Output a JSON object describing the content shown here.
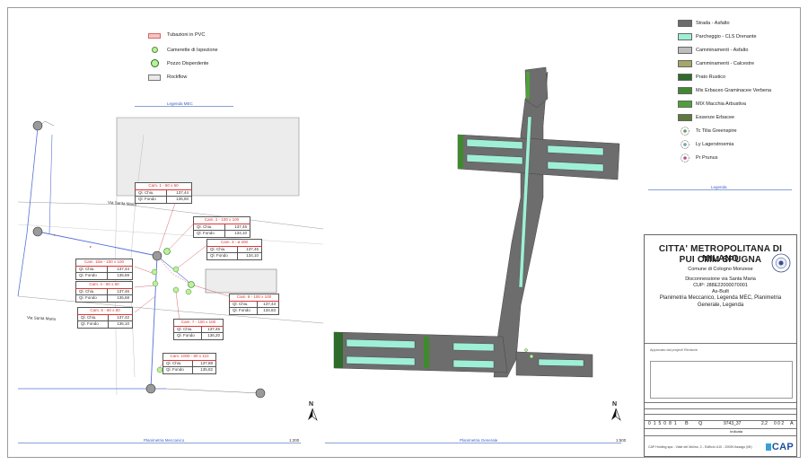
{
  "legend_left": {
    "items": [
      {
        "label": "Tubazioni in PVC",
        "symbol": "pvc-pipe"
      },
      {
        "label": "Camerette di Ispezione",
        "symbol": "inspection-chamber"
      },
      {
        "label": "Pozzo Disperdente",
        "symbol": "dispersing-well"
      },
      {
        "label": "Rockflow",
        "symbol": "rockflow"
      }
    ],
    "caption": "Legenda MEC"
  },
  "left_plan": {
    "street_labels": [
      "Via Santa Maria",
      "Via Santa Maria"
    ],
    "chambers": [
      {
        "title": "Cam. 1 - 60 x 60",
        "rows": [
          [
            "Ql. Chiu.",
            "137,44"
          ],
          [
            "Ql. Fondo",
            "135,80"
          ]
        ]
      },
      {
        "title": "Cam. 2 - 100 x 100",
        "rows": [
          [
            "Ql. Chiu.",
            "137,45"
          ],
          [
            "Ql. Fondo",
            "134,10"
          ]
        ]
      },
      {
        "title": "Cam. 3 - ø 200",
        "rows": [
          [
            "Ql. Chiu.",
            "137,45"
          ],
          [
            "Ql. Fondo",
            "134,10"
          ]
        ]
      },
      {
        "title": "Cam. 1bis - 100 x 100",
        "rows": [
          [
            "Ql. Chiu.",
            "137,44"
          ],
          [
            "Ql. Fondo",
            "135,59"
          ]
        ]
      },
      {
        "title": "Cam. 4 - 60 x 60",
        "rows": [
          [
            "Ql. Chiu.",
            "137,46"
          ],
          [
            "Ql. Fondo",
            "135,68"
          ]
        ]
      },
      {
        "title": "Cam. 6 - 60 x 60",
        "rows": [
          [
            "Ql. Chiu.",
            "137,42"
          ],
          [
            "Ql. Fondo",
            "136,10"
          ]
        ]
      },
      {
        "title": "Cam. 8 - 100 x 100",
        "rows": [
          [
            "Ql. Chiu.",
            "137,43"
          ],
          [
            "Ql. Fondo",
            "134,83"
          ]
        ]
      },
      {
        "title": "Cam. 7 - 100 x 100",
        "rows": [
          [
            "Ql. Chiu.",
            "137,45"
          ],
          [
            "Ql. Fondo",
            "136,20"
          ]
        ]
      },
      {
        "title": "Cam. 1000 - 80 x 110",
        "rows": [
          [
            "Ql. Chiu.",
            "137,88"
          ],
          [
            "Ql. Fondo",
            "135,82"
          ]
        ]
      }
    ],
    "caption": "Planimetria Meccanico",
    "scale": "1:200"
  },
  "right_plan": {
    "caption": "Planimetria Generale",
    "scale": "1:500"
  },
  "north_label": "N",
  "legend_right": {
    "items": [
      {
        "label": "Strada - Asfalto",
        "color": "#6d6d6d"
      },
      {
        "label": "Parcheggio - CLS Drenante",
        "color": "#9fefd6"
      },
      {
        "label": "Camminamenti - Asfalto",
        "color": "#bdbdbd"
      },
      {
        "label": "Camminamenti - Calcestre",
        "color": "#a6a668"
      },
      {
        "label": "Prato Rustico",
        "color": "#2f6b2a"
      },
      {
        "label": "Mix Erbaceo Graminacee Verbena",
        "color": "#3f8a2e"
      },
      {
        "label": "MIX Macchia Arbustiva",
        "color": "#4fa03a"
      },
      {
        "label": "Essenze Erbacee",
        "color": "#5c7a3a"
      },
      {
        "label": "Tc Tilia Greenspire",
        "color": "#6a9a6a"
      },
      {
        "label": "Ly Lagerstroemia",
        "color": "#7aa0b0"
      },
      {
        "label": "Pr Prunus",
        "color": "#b0578a"
      }
    ],
    "caption": "Legenda"
  },
  "title_block": {
    "line1": "CITTA' METROPOLITANA DI MILANO",
    "line2": "PUI CMM SPUGNA",
    "municipality": "Comune di Cologno Monzese",
    "subject": "Disconnessione via Santa Maria",
    "cup": "CUP: J88E22000070001",
    "status": "As-Built",
    "description": "Planimetria Meccanico, Legenda MEC, Planimetria Generale, Legenda",
    "approval_label": "Approvato dal project/ Revisore",
    "code_cells": [
      "0 1 5 0 8 1",
      "B",
      "Q",
      "9743_37",
      "2.2",
      "0 0 2",
      "A"
    ],
    "company": "CAP Holding spa - Viale del Mulino, 2 - Edificio U10 - 20090 Assago (MI)",
    "logo_text": "CAP",
    "map_label": "Indicata"
  }
}
